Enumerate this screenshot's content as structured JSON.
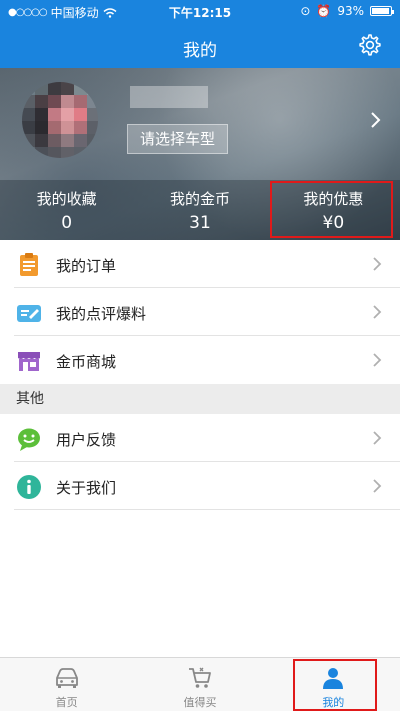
{
  "status_bar": {
    "carrier": "中国移动",
    "time": "下午12:15",
    "battery": "93%"
  },
  "nav": {
    "title": "我的"
  },
  "profile": {
    "car_button": "请选择车型"
  },
  "stats": [
    {
      "label": "我的收藏",
      "value": "0"
    },
    {
      "label": "我的金币",
      "value": "31"
    },
    {
      "label": "我的优惠",
      "value": "¥0"
    }
  ],
  "menu": {
    "orders": "我的订单",
    "reviews": "我的点评爆料",
    "coin_mall": "金币商城",
    "section_other": "其他",
    "feedback": "用户反馈",
    "about": "关于我们"
  },
  "tabs": [
    {
      "label": "首页"
    },
    {
      "label": "值得买"
    },
    {
      "label": "我的"
    }
  ],
  "colors": {
    "accent": "#1a84de",
    "highlight_box": "#e01a1a"
  }
}
